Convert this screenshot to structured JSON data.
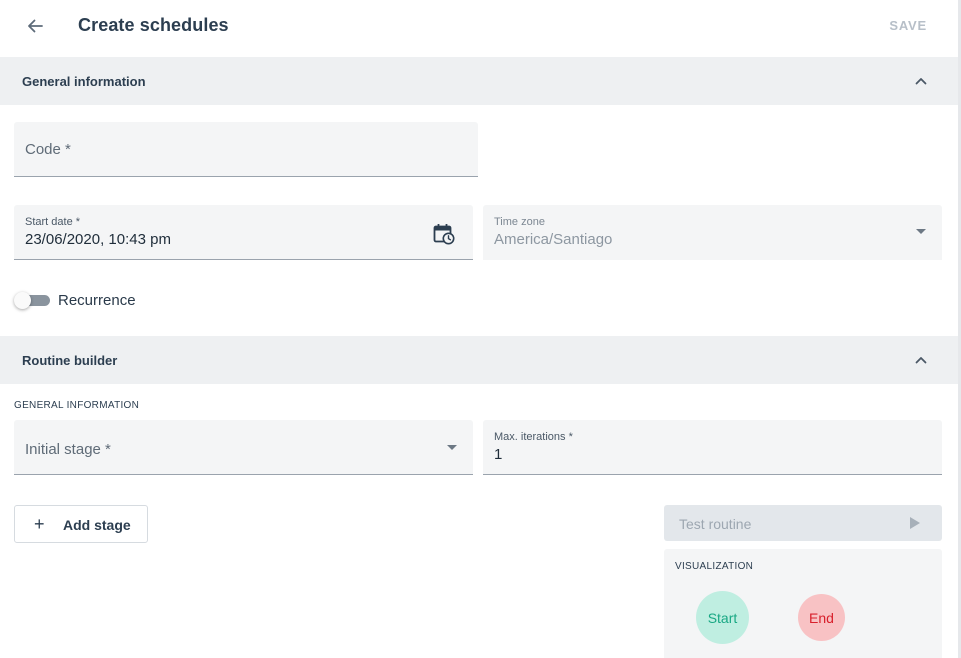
{
  "header": {
    "title": "Create schedules",
    "save_label": "SAVE"
  },
  "general_information": {
    "title": "General information",
    "code": {
      "label": "Code *",
      "value": ""
    },
    "start_date": {
      "label": "Start date *",
      "value": "23/06/2020, 10:43 pm"
    },
    "time_zone": {
      "label": "Time zone",
      "value": "America/Santiago"
    },
    "recurrence": {
      "label": "Recurrence",
      "enabled": false
    }
  },
  "routine_builder": {
    "title": "Routine builder",
    "subheading": "GENERAL INFORMATION",
    "initial_stage": {
      "label": "Initial stage *",
      "value": ""
    },
    "max_iterations": {
      "label": "Max. iterations *",
      "value": "1"
    },
    "add_stage_label": "Add stage",
    "test_routine_label": "Test routine",
    "visualization": {
      "title": "VISUALIZATION",
      "start_node": "Start",
      "end_node": "End"
    }
  },
  "colors": {
    "section_bg": "#eef0f2",
    "field_bg": "#f4f5f6",
    "start_node_bg": "#bfeee1",
    "start_node_text": "#19a884",
    "end_node_bg": "#f8c2c4",
    "end_node_text": "#d8202c"
  },
  "icons": [
    "arrow-left-icon",
    "chevron-up-icon",
    "calendar-clock-icon",
    "dropdown-arrow-icon",
    "plus-icon",
    "play-icon"
  ]
}
